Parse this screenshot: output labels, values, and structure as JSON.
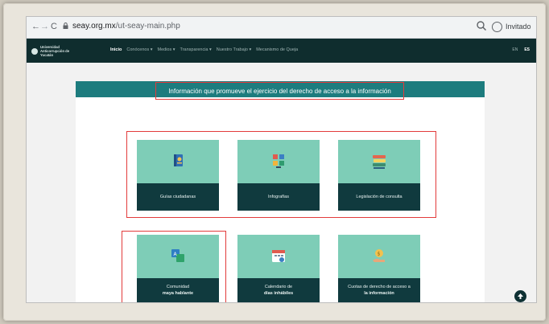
{
  "browser": {
    "back": "←",
    "forward": "→",
    "reload": "C",
    "url_host": "seay.org.mx",
    "url_path": "/ut-seay-main.php",
    "profile_label": "Invitado"
  },
  "site": {
    "logo_text": "Universidad Anticorrupción de Yucatán",
    "menu": [
      {
        "label": "Inicio",
        "active": true
      },
      {
        "label": "Conócenos ▾"
      },
      {
        "label": "Medios ▾"
      },
      {
        "label": "Transparencia ▾"
      },
      {
        "label": "Nuestro Trabajo ▾"
      },
      {
        "label": "Mecanismo de Queja"
      }
    ],
    "lang_en": "EN",
    "lang_es": "ES"
  },
  "panel": {
    "title": "Información que promueve el ejercicio del derecho de acceso a la información"
  },
  "cards": [
    {
      "line1": "Guías ciudadanas",
      "line2": "",
      "icon": "book-icon"
    },
    {
      "line1": "Infografías",
      "line2": "",
      "icon": "infographic-icon"
    },
    {
      "line1": "Legislación de consulta",
      "line2": "",
      "icon": "books-stack-icon"
    },
    {
      "line1": "Comunidad",
      "line2": "maya hablante",
      "icon": "translate-icon"
    },
    {
      "line1": "Calendario de",
      "line2": "días inhábiles",
      "icon": "calendar-icon"
    },
    {
      "line1": "Cuotas de derecho de acceso a",
      "line2": "la información",
      "icon": "money-hand-icon"
    }
  ],
  "colors": {
    "header_dark": "#0f2d2e",
    "panel_head": "#1d7c7e",
    "card_top": "#7ecdb7",
    "card_bottom": "#103a3e",
    "highlight_red": "#e23b3b"
  }
}
